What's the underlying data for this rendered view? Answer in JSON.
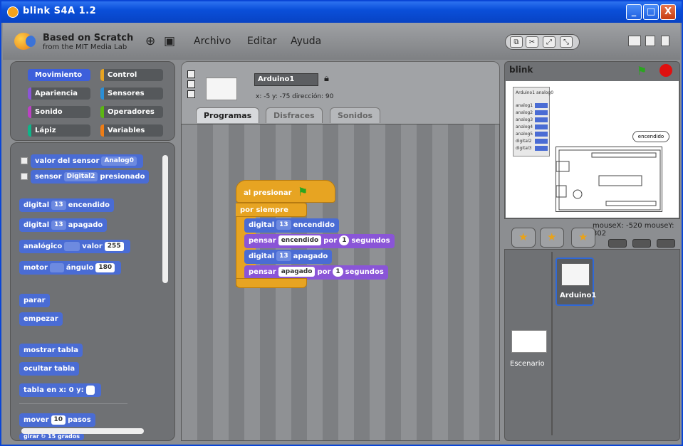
{
  "window": {
    "title": "blink S4A 1.2",
    "btn_min": "_",
    "btn_max": "□",
    "btn_close": "X"
  },
  "topbar": {
    "logo_line1": "Based on Scratch",
    "logo_line2": "from the MIT Media Lab",
    "menus": [
      "Archivo",
      "Editar",
      "Ayuda"
    ]
  },
  "categories": [
    {
      "label": "Movimiento",
      "color": "#3d5fdb"
    },
    {
      "label": "Control",
      "color": "#e7a422"
    },
    {
      "label": "Apariencia",
      "color": "#8a55d7"
    },
    {
      "label": "Sensores",
      "color": "#2b8fd6"
    },
    {
      "label": "Sonido",
      "color": "#bb42c3"
    },
    {
      "label": "Operadores",
      "color": "#5cb712"
    },
    {
      "label": "Lápiz",
      "color": "#0eb589"
    },
    {
      "label": "Variables",
      "color": "#ee7d16"
    }
  ],
  "palette": {
    "sensor_value": "valor del sensor",
    "sensor_arg": "Analog0",
    "sensor_dig": "sensor",
    "sensor_dig_arg": "Digital2",
    "sensor_dig_tail": "presionado",
    "digital_on": "digital",
    "digital_on_pin": "13",
    "digital_on_tail": "encendido",
    "digital_off": "digital",
    "digital_off_pin": "13",
    "digital_off_tail": "apagado",
    "analog": "analógico",
    "analog_tail": "valor",
    "analog_val": "255",
    "motor": "motor",
    "motor_tail": "ángulo",
    "motor_val": "180",
    "stop": "parar",
    "reset": "empezar",
    "board_show": "mostrar tabla",
    "board_hide": "ocultar tabla",
    "board_xy": "tabla en x: 0 y:",
    "move": "mover",
    "move_val": "10",
    "move_tail": "pasos",
    "next": "girar ↻ 15 grados"
  },
  "sprite": {
    "name": "Arduino1",
    "coords": "x: -5  y: -75   dirección: 90",
    "tabs": [
      "Programas",
      "Disfraces",
      "Sonidos"
    ]
  },
  "script": {
    "hat": "al presionar",
    "forever": "por siempre",
    "b1": "digital",
    "b1_pin": "13",
    "b1_tail": "encendido",
    "b2": "pensar",
    "b2_txt": "encendido",
    "b2_mid": "por",
    "b2_num": "1",
    "b2_tail": "segundos",
    "b3": "digital",
    "b3_pin": "13",
    "b3_tail": "apagado",
    "b4": "pensar",
    "b4_txt": "apagado",
    "b4_mid": "por",
    "b4_num": "1",
    "b4_tail": "segundos"
  },
  "stage": {
    "title": "blink",
    "bubble": "encendido",
    "mouse": "mouseX: -520  mouseY: 302",
    "monitor": [
      "Arduino1 analog0",
      "analog1",
      "analog2",
      "analog3",
      "analog4",
      "analog5",
      "digital2",
      "digital3"
    ]
  },
  "sprites": {
    "stage_label": "Escenario",
    "sprite_label": "Arduino1"
  }
}
